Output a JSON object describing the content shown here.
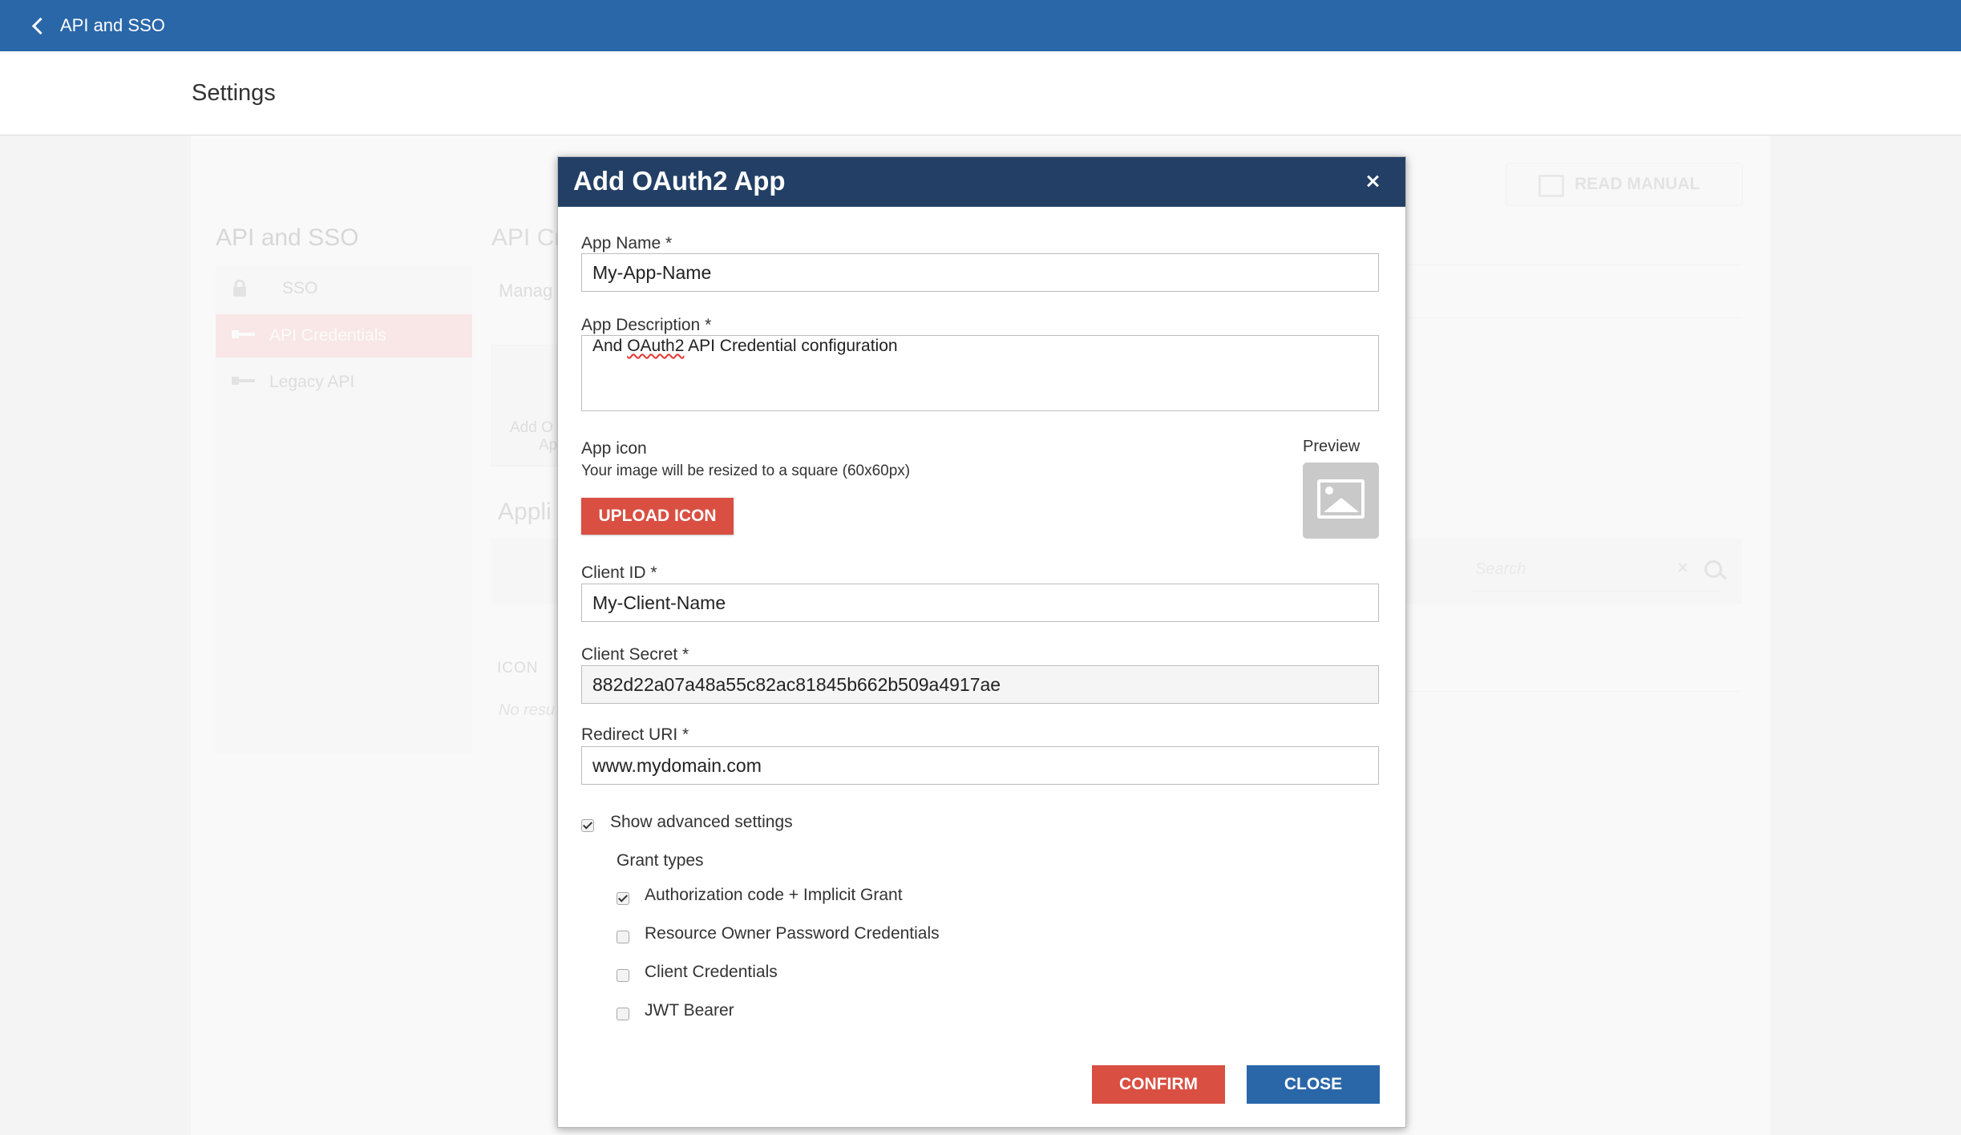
{
  "topbar": {
    "back_label": "API and SSO"
  },
  "settings": {
    "title": "Settings"
  },
  "background": {
    "sidebar_title": "API and SSO",
    "sidebar_items": [
      {
        "label": "SSO",
        "icon": "lock-icon"
      },
      {
        "label": "API Credentials",
        "icon": "key-icon"
      },
      {
        "label": "Legacy API",
        "icon": "key-icon"
      }
    ],
    "main_title": "API Cr",
    "manage_text": "Manag",
    "add_card_text": "Add O",
    "add_card_text2": "Ap",
    "apps_title": "Appli",
    "search_placeholder": "Search",
    "icon_column": "ICON",
    "no_results": "No resu",
    "read_manual": "READ MANUAL"
  },
  "modal": {
    "title": "Add OAuth2 App",
    "fields": {
      "app_name": {
        "label": "App Name *",
        "value": "My-App-Name"
      },
      "app_description": {
        "label": "App Description *",
        "value_prefix": "And ",
        "value_squiggle": "OAuth2",
        "value_suffix": " API Credential configuration"
      },
      "app_icon": {
        "label": "App icon",
        "hint": "Your image will be resized to a square (60x60px)",
        "upload_label": "UPLOAD ICON",
        "preview_label": "Preview"
      },
      "client_id": {
        "label": "Client ID *",
        "value": "My-Client-Name"
      },
      "client_secret": {
        "label": "Client Secret *",
        "value": "882d22a07a48a55c82ac81845b662b509a4917ae"
      },
      "redirect_uri": {
        "label": "Redirect URI *",
        "value": "www.mydomain.com"
      }
    },
    "advanced": {
      "label": "Show advanced settings",
      "checked": true,
      "grant_types_label": "Grant types",
      "grant_types": [
        {
          "label": "Authorization code + Implicit Grant",
          "checked": true
        },
        {
          "label": "Resource Owner Password Credentials",
          "checked": false
        },
        {
          "label": "Client Credentials",
          "checked": false
        },
        {
          "label": "JWT Bearer",
          "checked": false
        }
      ]
    },
    "confirm_label": "CONFIRM",
    "close_label": "CLOSE"
  },
  "colors": {
    "topbar": "#2a67a9",
    "modal_header": "#233f66",
    "danger": "#d94f42",
    "primary": "#2a67a9"
  }
}
